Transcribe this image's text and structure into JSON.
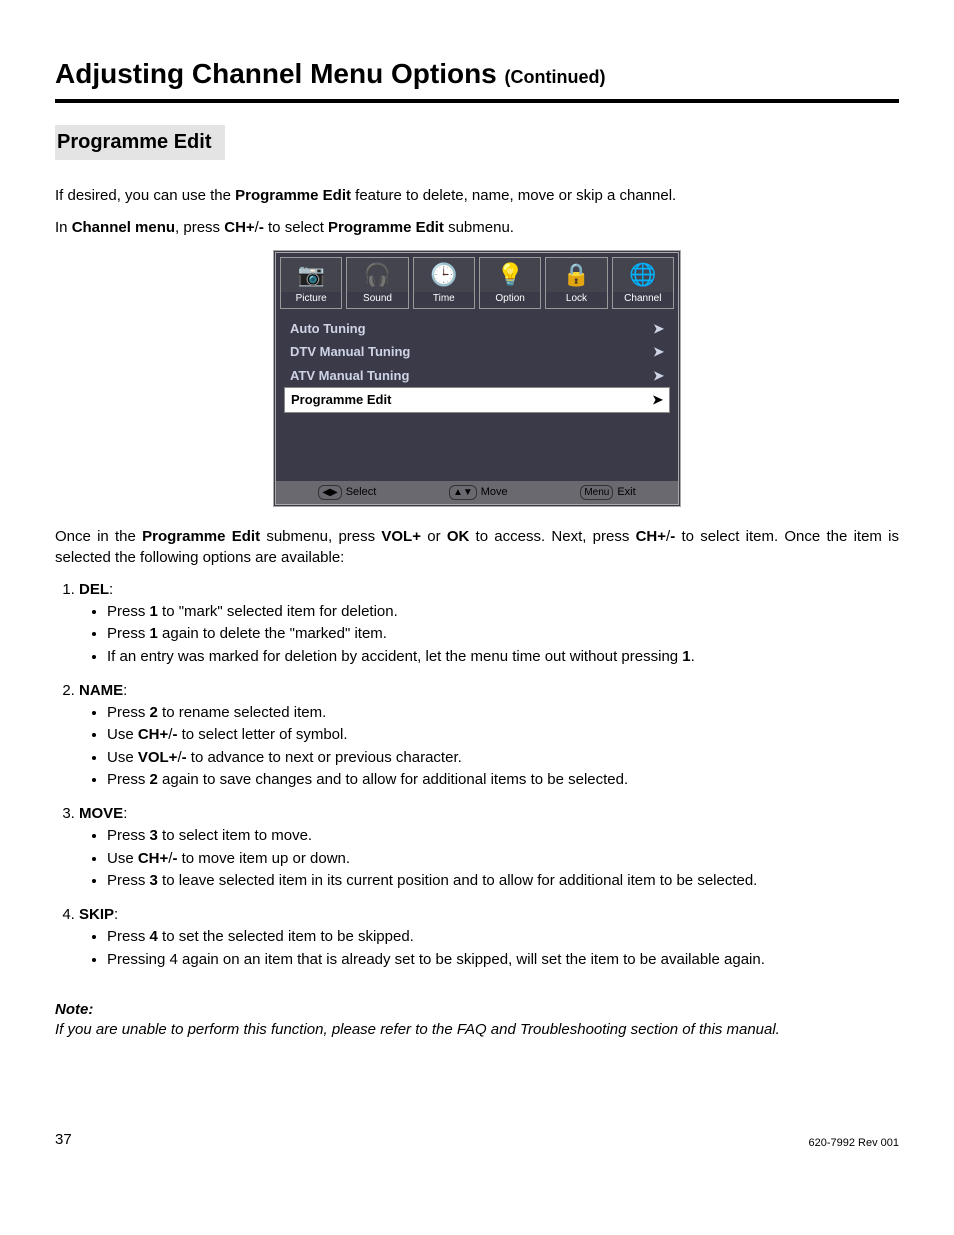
{
  "title": "Adjusting Channel Menu Options",
  "title_cont": "(Continued)",
  "section_heading": "Programme Edit",
  "intro1a": "If desired, you can use the ",
  "intro1b": "Programme Edit",
  "intro1c": " feature to delete, name, move or skip a channel.",
  "intro2a": "In ",
  "intro2b": "Channel menu",
  "intro2c": ", press ",
  "intro2d": "CH+",
  "intro2e": "/",
  "intro2f": "-",
  "intro2g": " to select ",
  "intro2h": "Programme Edit",
  "intro2i": " submenu.",
  "tabs": [
    "Picture",
    "Sound",
    "Time",
    "Option",
    "Lock",
    "Channel"
  ],
  "tab_icons": [
    "📷",
    "🎧",
    "🕒",
    "💡",
    "🔒",
    "🌐"
  ],
  "menu": [
    {
      "label": "Auto Tuning",
      "selected": false
    },
    {
      "label": "DTV Manual Tuning",
      "selected": false
    },
    {
      "label": "ATV Manual Tuning",
      "selected": false
    },
    {
      "label": "Programme Edit",
      "selected": true
    }
  ],
  "bar": {
    "select": "Select",
    "move": "Move",
    "menu": "Menu",
    "exit": "Exit"
  },
  "para2a": "Once in the ",
  "para2b": "Programme Edit",
  "para2c": " submenu, press ",
  "para2d": "VOL+",
  "para2e": " or ",
  "para2f": "OK",
  "para2g": " to access.  Next, press ",
  "para2h": "CH+",
  "para2i": "/",
  "para2j": "-",
  "para2k": " to select item. Once the item is selected the following options are available:",
  "del_h": "DEL",
  "del": [
    {
      "pre": "Press ",
      "b": "1",
      "post": " to \"mark\" selected item for deletion."
    },
    {
      "pre": "Press ",
      "b": "1",
      "post": " again to delete the \"marked\" item."
    },
    {
      "pre": "If an entry was marked for deletion by accident, let the menu time out without pressing ",
      "b": "1",
      "post": "."
    }
  ],
  "name_h": "NAME",
  "name": [
    {
      "pre": "Press ",
      "b": "2",
      "post": " to rename selected item."
    },
    {
      "pre": "Use ",
      "b": "CH+",
      "mid": "/",
      "b2": "-",
      "post": " to select letter of symbol."
    },
    {
      "pre": "Use ",
      "b": "VOL+",
      "mid": "/",
      "b2": "-",
      "post": " to advance to next or previous character."
    },
    {
      "pre": "Press ",
      "b": "2",
      "post": " again to save changes and to allow for additional items to be selected."
    }
  ],
  "move_h": "MOVE",
  "move": [
    {
      "pre": "Press ",
      "b": "3",
      "post": " to select item to move."
    },
    {
      "pre": "Use ",
      "b": "CH+",
      "mid": "/",
      "b2": "-",
      "post": " to move item up or down."
    },
    {
      "pre": "Press ",
      "b": "3",
      "post": " to leave selected item in its current position and to allow for additional item to be selected."
    }
  ],
  "skip_h": "SKIP",
  "skip": [
    {
      "pre": "Press ",
      "b": "4",
      "post": " to set the selected item to be skipped."
    },
    {
      "pre": "Pressing 4 again on an item that is already set to be skipped, will set the item to be available again.",
      "b": "",
      "post": ""
    }
  ],
  "note_h": "Note:",
  "note_t": "If you are unable to perform this function, please refer to the FAQ and Troubleshooting section of this manual.",
  "page_num": "37",
  "rev": "620-7992 Rev 001"
}
